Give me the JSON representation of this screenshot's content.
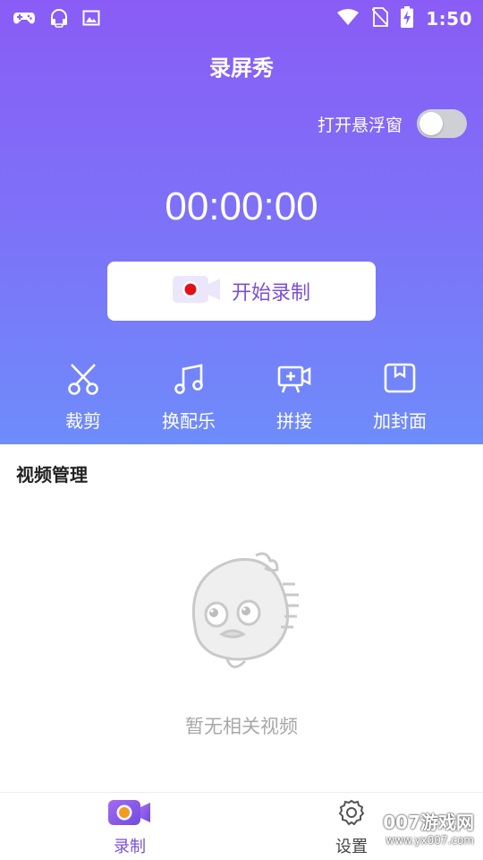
{
  "status_bar": {
    "time": "1:50",
    "left_icons": [
      "gamepad-icon",
      "headset-icon",
      "image-icon"
    ],
    "right_icons": [
      "wifi-icon",
      "no-sim-icon",
      "battery-charging-icon"
    ]
  },
  "header": {
    "title": "录屏秀"
  },
  "float_window": {
    "label": "打开悬浮窗",
    "enabled": false
  },
  "recorder": {
    "timer": "00:00:00",
    "start_label": "开始录制"
  },
  "tools": [
    {
      "label": "裁剪",
      "icon": "scissors-icon"
    },
    {
      "label": "换配乐",
      "icon": "music-note-icon"
    },
    {
      "label": "拼接",
      "icon": "video-add-icon"
    },
    {
      "label": "加封面",
      "icon": "cover-icon"
    }
  ],
  "video_management": {
    "title": "视频管理",
    "empty_text": "暂无相关视频"
  },
  "bottom_nav": [
    {
      "label": "录制",
      "icon": "video-camera-icon",
      "active": true
    },
    {
      "label": "设置",
      "icon": "gear-icon",
      "active": false
    }
  ],
  "watermark": {
    "main": "007游戏网",
    "url": "www.yx007.com"
  },
  "colors": {
    "accent": "#7b4fd6",
    "hero_top": "#8a5cf6",
    "hero_bottom": "#6e8cfb"
  }
}
